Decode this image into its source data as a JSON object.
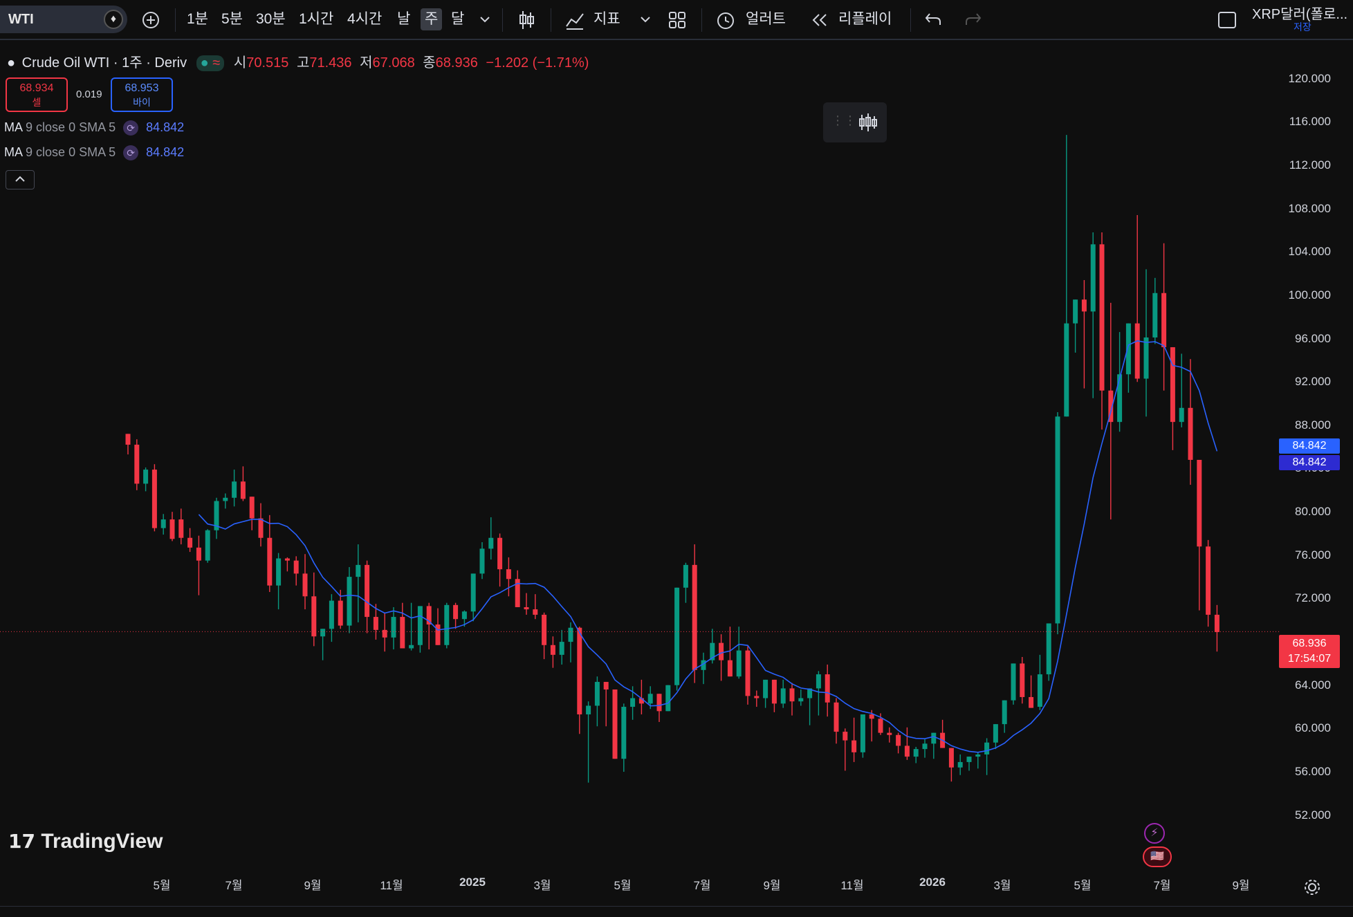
{
  "toolbar": {
    "symbol": "WTI",
    "intervals": [
      "1분",
      "5분",
      "30분",
      "1시간",
      "4시간",
      "날",
      "주",
      "달"
    ],
    "active_interval": "주",
    "indicators_label": "지표",
    "alert_label": "얼러트",
    "replay_label": "리플레이",
    "right_title": "XRP달러(폴로...",
    "save_label": "저장"
  },
  "legend": {
    "title": "Crude Oil WTI · 1주 · Deriv",
    "open_label": "시",
    "open": "70.515",
    "high_label": "고",
    "high": "71.436",
    "low_label": "저",
    "low": "67.068",
    "close_label": "종",
    "close": "68.936",
    "change": "−1.202 (−1.71%)",
    "sell_price": "68.934",
    "sell_label": "셀",
    "spread": "0.019",
    "buy_price": "68.953",
    "buy_label": "바이",
    "ma1_name": "MA",
    "ma1_params": "9 close 0 SMA 5",
    "ma1_value": "84.842",
    "ma2_name": "MA",
    "ma2_params": "9 close 0 SMA 5",
    "ma2_value": "84.842"
  },
  "price_axis": {
    "labels": [
      "120.000",
      "116.000",
      "112.000",
      "108.000",
      "104.000",
      "100.000",
      "96.000",
      "92.000",
      "88.000",
      "84.000",
      "80.000",
      "76.000",
      "72.000",
      "64.000",
      "60.000",
      "56.000",
      "52.000"
    ],
    "ma_tag_1": "84.842",
    "ma_tag_2": "84.842",
    "last_price": "68.936",
    "countdown": "17:54:07"
  },
  "time_axis": {
    "labels": [
      "5월",
      "7월",
      "9월",
      "11월",
      "2025",
      "3월",
      "5월",
      "7월",
      "9월",
      "11월",
      "2026",
      "3월",
      "5월",
      "7월",
      "9월"
    ]
  },
  "watermark": "TradingView",
  "colors": {
    "up": "#089981",
    "down": "#f23645",
    "ma": "#2962ff",
    "bg": "#0f0f0f"
  },
  "chart_data": {
    "type": "candlestick",
    "ylim": [
      50,
      121
    ],
    "candles": [
      [
        87.2,
        87.0,
        85.3,
        86.2
      ],
      [
        86.2,
        86.7,
        82.0,
        82.6
      ],
      [
        82.6,
        84.1,
        81.9,
        83.9
      ],
      [
        83.9,
        84.4,
        78.2,
        78.5
      ],
      [
        78.5,
        79.8,
        77.9,
        79.3
      ],
      [
        79.3,
        80.0,
        77.3,
        77.5
      ],
      [
        79.3,
        80.3,
        77.0,
        77.6
      ],
      [
        77.6,
        78.5,
        76.3,
        76.7
      ],
      [
        76.7,
        77.8,
        72.3,
        75.5
      ],
      [
        75.5,
        78.4,
        75.3,
        78.3
      ],
      [
        78.3,
        81.3,
        77.5,
        81.0
      ],
      [
        81.0,
        81.7,
        80.3,
        81.3
      ],
      [
        81.3,
        83.9,
        80.5,
        82.8
      ],
      [
        82.8,
        84.2,
        81.0,
        81.2
      ],
      [
        81.4,
        81.3,
        78.3,
        79.4
      ],
      [
        79.4,
        80.8,
        76.8,
        77.6
      ],
      [
        77.6,
        79.7,
        72.6,
        73.2
      ],
      [
        73.2,
        76.2,
        71.0,
        75.7
      ],
      [
        75.7,
        75.8,
        74.5,
        75.5
      ],
      [
        75.5,
        75.9,
        73.2,
        74.3
      ],
      [
        74.3,
        76.1,
        71.0,
        72.2
      ],
      [
        72.2,
        74.4,
        67.6,
        68.5
      ],
      [
        68.5,
        69.1,
        66.3,
        69.2
      ],
      [
        69.2,
        72.4,
        68.0,
        71.8
      ],
      [
        71.8,
        72.8,
        69.2,
        69.5
      ],
      [
        69.5,
        74.9,
        68.8,
        74.0
      ],
      [
        74.0,
        77.0,
        69.8,
        75.1
      ],
      [
        75.1,
        75.5,
        68.8,
        70.3
      ],
      [
        70.3,
        71.5,
        68.2,
        69.1
      ],
      [
        69.1,
        70.7,
        67.1,
        68.4
      ],
      [
        68.4,
        71.2,
        67.3,
        70.3
      ],
      [
        70.3,
        71.6,
        68.0,
        67.4
      ],
      [
        67.4,
        71.6,
        67.2,
        67.7
      ],
      [
        67.7,
        70.1,
        67.0,
        71.3
      ],
      [
        71.3,
        71.6,
        67.3,
        69.6
      ],
      [
        69.6,
        71.1,
        68.0,
        67.7
      ],
      [
        67.7,
        71.6,
        67.4,
        71.4
      ],
      [
        71.4,
        71.6,
        69.2,
        70.1
      ],
      [
        70.1,
        70.9,
        69.4,
        70.8
      ],
      [
        70.8,
        74.2,
        69.9,
        74.3
      ],
      [
        74.3,
        77.2,
        73.8,
        76.6
      ],
      [
        76.6,
        79.5,
        75.6,
        77.6
      ],
      [
        77.6,
        78.0,
        73.1,
        74.7
      ],
      [
        74.7,
        75.8,
        72.2,
        73.8
      ],
      [
        73.8,
        74.6,
        72.0,
        71.2
      ],
      [
        71.2,
        72.5,
        70.5,
        71.0
      ],
      [
        71.0,
        72.4,
        70.1,
        70.5
      ],
      [
        70.5,
        70.7,
        66.4,
        67.7
      ],
      [
        67.7,
        68.5,
        65.6,
        66.8
      ],
      [
        66.8,
        69.1,
        65.9,
        68.0
      ],
      [
        68.0,
        69.8,
        66.1,
        69.3
      ],
      [
        69.3,
        69.4,
        59.5,
        61.3
      ],
      [
        61.3,
        62.5,
        55.0,
        62.1
      ],
      [
        62.1,
        64.8,
        60.2,
        64.3
      ],
      [
        64.3,
        63.7,
        60.2,
        63.6
      ],
      [
        63.6,
        62.3,
        57.8,
        57.2
      ],
      [
        57.2,
        62.3,
        56.0,
        62.0
      ],
      [
        62.0,
        63.9,
        60.8,
        62.8
      ],
      [
        62.8,
        64.5,
        61.3,
        62.3
      ],
      [
        62.3,
        63.9,
        61.8,
        63.2
      ],
      [
        63.2,
        63.2,
        60.6,
        61.6
      ],
      [
        61.6,
        61.6,
        64.9,
        64.0
      ],
      [
        64.0,
        72.5,
        63.5,
        73.0
      ],
      [
        73.0,
        75.3,
        71.6,
        75.1
      ],
      [
        75.1,
        77.0,
        64.2,
        65.4
      ],
      [
        65.4,
        67.0,
        64.1,
        66.3
      ],
      [
        66.3,
        69.2,
        66.0,
        67.9
      ],
      [
        67.9,
        68.7,
        64.4,
        66.3
      ],
      [
        66.3,
        69.4,
        64.9,
        64.8
      ],
      [
        64.8,
        69.4,
        64.6,
        67.2
      ],
      [
        67.2,
        67.6,
        62.2,
        63.0
      ],
      [
        63.0,
        63.5,
        62.0,
        62.8
      ],
      [
        62.8,
        63.9,
        61.9,
        64.5
      ],
      [
        64.5,
        64.4,
        61.5,
        62.3
      ],
      [
        62.3,
        64.5,
        61.9,
        63.7
      ],
      [
        63.7,
        64.2,
        61.2,
        62.5
      ],
      [
        62.5,
        63.6,
        62.1,
        62.8
      ],
      [
        62.8,
        63.2,
        60.3,
        63.7
      ],
      [
        63.7,
        65.3,
        61.2,
        65.0
      ],
      [
        65.0,
        65.9,
        61.1,
        62.4
      ],
      [
        62.4,
        62.8,
        58.6,
        59.7
      ],
      [
        59.7,
        60.0,
        56.1,
        58.9
      ],
      [
        58.9,
        61.0,
        56.9,
        57.8
      ],
      [
        57.8,
        61.0,
        57.3,
        61.3
      ],
      [
        61.3,
        61.7,
        58.8,
        60.9
      ],
      [
        60.9,
        61.4,
        59.4,
        59.6
      ],
      [
        59.6,
        60.1,
        58.7,
        59.4
      ],
      [
        59.4,
        59.6,
        57.7,
        58.4
      ],
      [
        58.4,
        60.1,
        57.1,
        57.4
      ],
      [
        57.4,
        58.3,
        56.8,
        58.1
      ],
      [
        58.1,
        59.0,
        57.3,
        58.6
      ],
      [
        58.6,
        59.6,
        57.2,
        59.6
      ],
      [
        59.6,
        60.8,
        58.4,
        58.2
      ],
      [
        58.2,
        56.9,
        55.1,
        56.4
      ],
      [
        56.4,
        57.6,
        55.7,
        56.9
      ],
      [
        56.9,
        57.1,
        56.1,
        57.4
      ],
      [
        57.4,
        57.8,
        56.3,
        57.6
      ],
      [
        57.6,
        59.1,
        55.7,
        58.7
      ],
      [
        58.7,
        60.0,
        58.1,
        60.4
      ],
      [
        60.4,
        60.8,
        59.6,
        62.6
      ],
      [
        62.6,
        65.9,
        62.2,
        66.0
      ],
      [
        66.0,
        66.6,
        62.3,
        62.9
      ],
      [
        62.9,
        64.9,
        61.9,
        61.9
      ],
      [
        62.0,
        66.8,
        61.7,
        65.0
      ],
      [
        65.0,
        68.4,
        64.4,
        69.7
      ],
      [
        69.7,
        89.2,
        68.7,
        88.8
      ],
      [
        88.8,
        114.8,
        94.8,
        97.4
      ],
      [
        97.4,
        99.5,
        94.7,
        99.6
      ],
      [
        99.6,
        101.4,
        91.4,
        98.5
      ],
      [
        98.5,
        105.8,
        90.5,
        104.7
      ],
      [
        104.7,
        105.8,
        87.6,
        91.2
      ],
      [
        91.2,
        99.3,
        79.3,
        88.3
      ],
      [
        88.3,
        96.6,
        87.4,
        92.7
      ],
      [
        92.7,
        96.5,
        91.0,
        97.4
      ],
      [
        97.4,
        107.4,
        92.0,
        92.3
      ],
      [
        92.3,
        102.4,
        88.8,
        96.1
      ],
      [
        96.1,
        101.6,
        95.5,
        100.2
      ],
      [
        100.2,
        104.8,
        91.2,
        95.2
      ],
      [
        95.2,
        93.1,
        85.7,
        88.3
      ],
      [
        88.3,
        94.6,
        87.8,
        89.6
      ],
      [
        89.6,
        94.1,
        82.5,
        84.8
      ],
      [
        84.8,
        82.3,
        70.9,
        76.8
      ],
      [
        76.8,
        77.4,
        69.4,
        70.5
      ],
      [
        70.5,
        71.4,
        67.1,
        68.9
      ]
    ],
    "ma_series_name": "MA 9 close 0 SMA 5",
    "ma_last": 84.842
  }
}
